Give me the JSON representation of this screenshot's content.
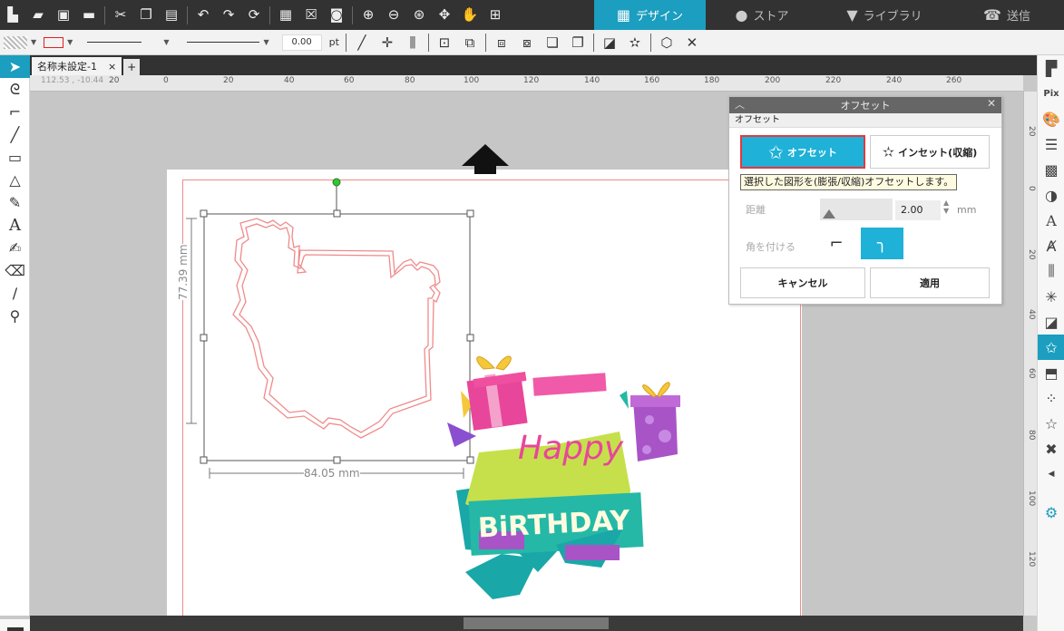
{
  "top_tabs": [
    {
      "label": "デザイン",
      "icon": "grid-icon",
      "active": true
    },
    {
      "label": "ストア",
      "icon": "store-icon",
      "active": false
    },
    {
      "label": "ライブラリ",
      "icon": "library-icon",
      "active": false
    },
    {
      "label": "送信",
      "icon": "send-icon",
      "active": false
    }
  ],
  "toolbar2": {
    "line_width": "0.00",
    "line_unit": "pt"
  },
  "document": {
    "tab_label": "名称未設定-1",
    "close_symbol": "×",
    "add_symbol": "+"
  },
  "ruler": {
    "h_labels": [
      "20",
      "0",
      "20",
      "40",
      "60",
      "80",
      "100",
      "120",
      "140",
      "160",
      "180",
      "200",
      "220",
      "240",
      "260"
    ],
    "coords": "112.53 , -10.44",
    "v_labels": [
      "20",
      "0",
      "20",
      "40",
      "60",
      "80",
      "100",
      "120"
    ]
  },
  "selection": {
    "width": "84.05 mm",
    "height": "77.39 mm"
  },
  "offset_panel": {
    "title": "オフセット",
    "section": "オフセット",
    "offset_button": "オフセット",
    "inset_button": "インセット(収縮)",
    "tooltip": "選択した図形を(膨張/収縮)オフセットします。",
    "distance_label": "距離",
    "distance_value": "2.00",
    "distance_unit": "mm",
    "corner_label": "角を付ける",
    "cancel_button": "キャンセル",
    "apply_button": "適用"
  },
  "artwork": {
    "line1": "Happy",
    "line2": "BiRTHDAY"
  },
  "colors": {
    "accent": "#1b9ebf",
    "panel_button": "#1fb1d8",
    "cut_line": "#f08a8a"
  }
}
